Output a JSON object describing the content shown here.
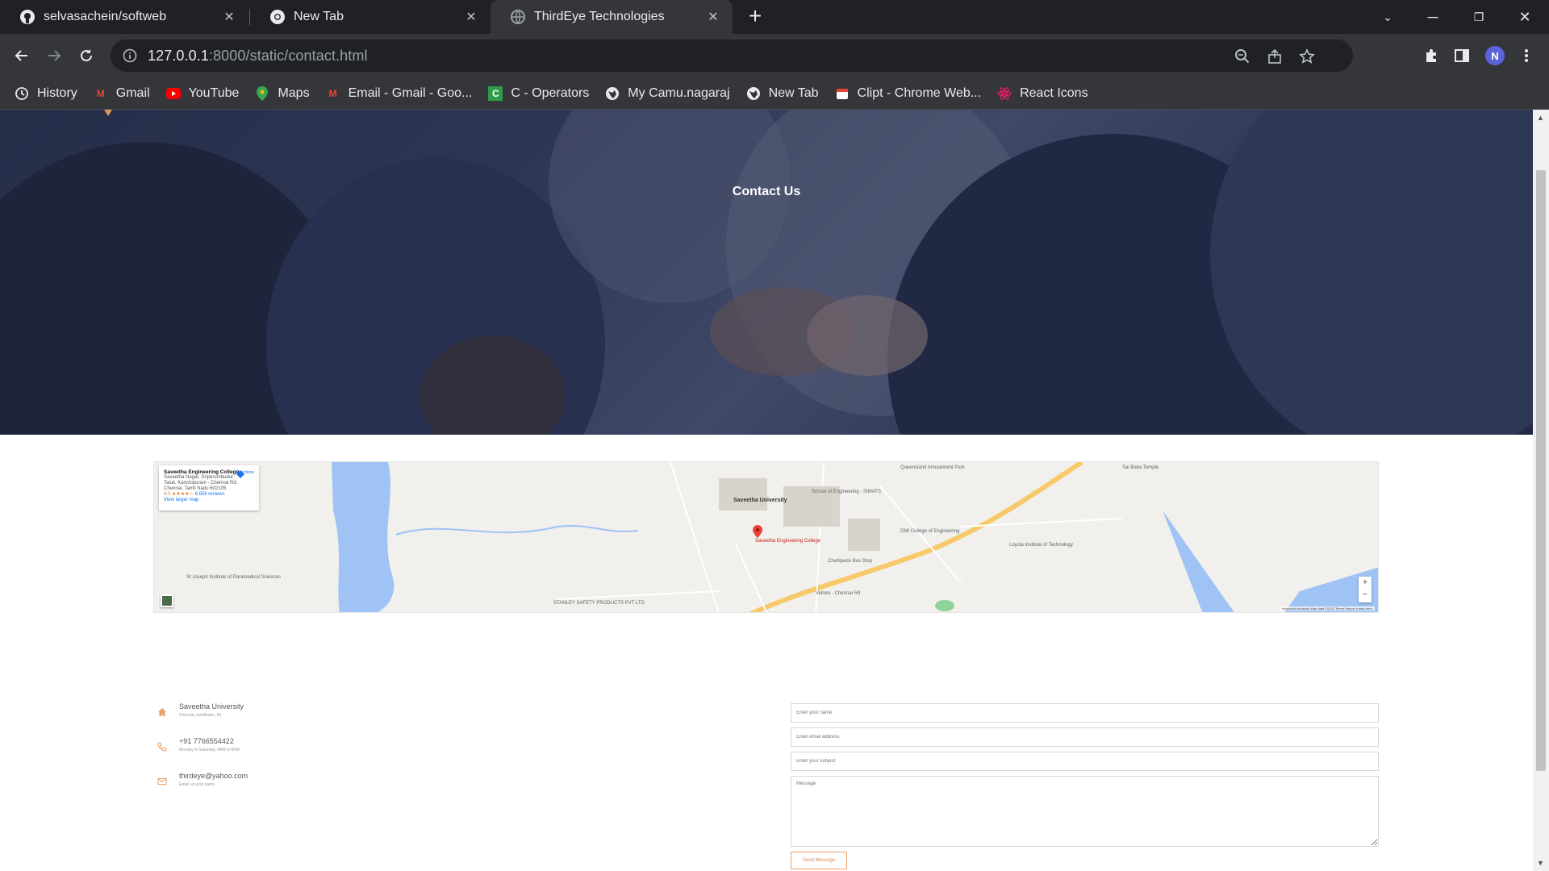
{
  "browser": {
    "tabs": [
      {
        "title": "selvasachein/softweb",
        "icon": "github-icon",
        "active": false
      },
      {
        "title": "New Tab",
        "icon": "chrome-icon",
        "active": false
      },
      {
        "title": "ThirdEye Technologies",
        "icon": "globe-icon",
        "active": true
      }
    ],
    "url_host": "127.0.0.1",
    "url_path": ":8000/static/contact.html",
    "profile_initial": "N",
    "bookmarks": [
      {
        "label": "History",
        "icon": "history-icon"
      },
      {
        "label": "Gmail",
        "icon": "gmail-icon"
      },
      {
        "label": "YouTube",
        "icon": "youtube-icon"
      },
      {
        "label": "Maps",
        "icon": "maps-icon"
      },
      {
        "label": "Email - Gmail - Goo...",
        "icon": "gmail-icon"
      },
      {
        "label": "C - Operators",
        "icon": "c-icon"
      },
      {
        "label": "My Camu.nagaraj",
        "icon": "globe-icon"
      },
      {
        "label": "New Tab",
        "icon": "globe-icon"
      },
      {
        "label": "Clipt - Chrome Web...",
        "icon": "clipt-icon"
      },
      {
        "label": "React Icons",
        "icon": "react-icon"
      }
    ]
  },
  "hero": {
    "title": "Contact Us"
  },
  "map": {
    "place_name": "Saveetha Engineering College",
    "place_address_1": "Saveetha Nagar, Sriperumbudur",
    "place_address_2": "Taluk, Kanchipuram - Chennai Rd,",
    "place_address_3": "Chennai, Tamil Nadu 602105",
    "rating": "4.3 ★★★★☆",
    "reviews": "6,656 reviews",
    "larger_map": "View larger map",
    "directions": "Directions",
    "labels": {
      "saveetha_university": "Saveetha University",
      "saveetha_college": "Saveetha Engineering College",
      "school_engineering": "School of Engineering - SIMATS",
      "dmi": "DMI College of Engineering",
      "velammal": "Chettipedu Bus Stop",
      "stanley": "STANLEY SAFETY PRODUCTS PVT LTD",
      "st_joseph": "St Joseph Institute of Paramedical Sciences",
      "loyola": "Loyola Institute of Technology",
      "queensland": "Queensland Amusement Park",
      "saibaba": "Sai Baba Temple",
      "velappanchavadi": "Vellore - Chennai Rd"
    },
    "footer": "Keyboard shortcuts   Map data ©2023   Terms   Report a map error"
  },
  "contact": {
    "address_main": "Saveetha University",
    "address_sub": "Chennai, tamilNadu, IN",
    "phone_main": "+91 7766554422",
    "phone_sub": "Monday to Saturday, 9AM to 6PM",
    "email_main": "thirdeye@yahoo.com",
    "email_sub": "Email us your query"
  },
  "form": {
    "name_placeholder": "Enter your name",
    "email_placeholder": "Enter email address",
    "subject_placeholder": "Enter your subject",
    "message_placeholder": "Message",
    "submit_label": "Send Message"
  },
  "colors": {
    "accent": "#e9a06b",
    "chrome_dark": "#202124",
    "chrome_mid": "#35363a"
  }
}
